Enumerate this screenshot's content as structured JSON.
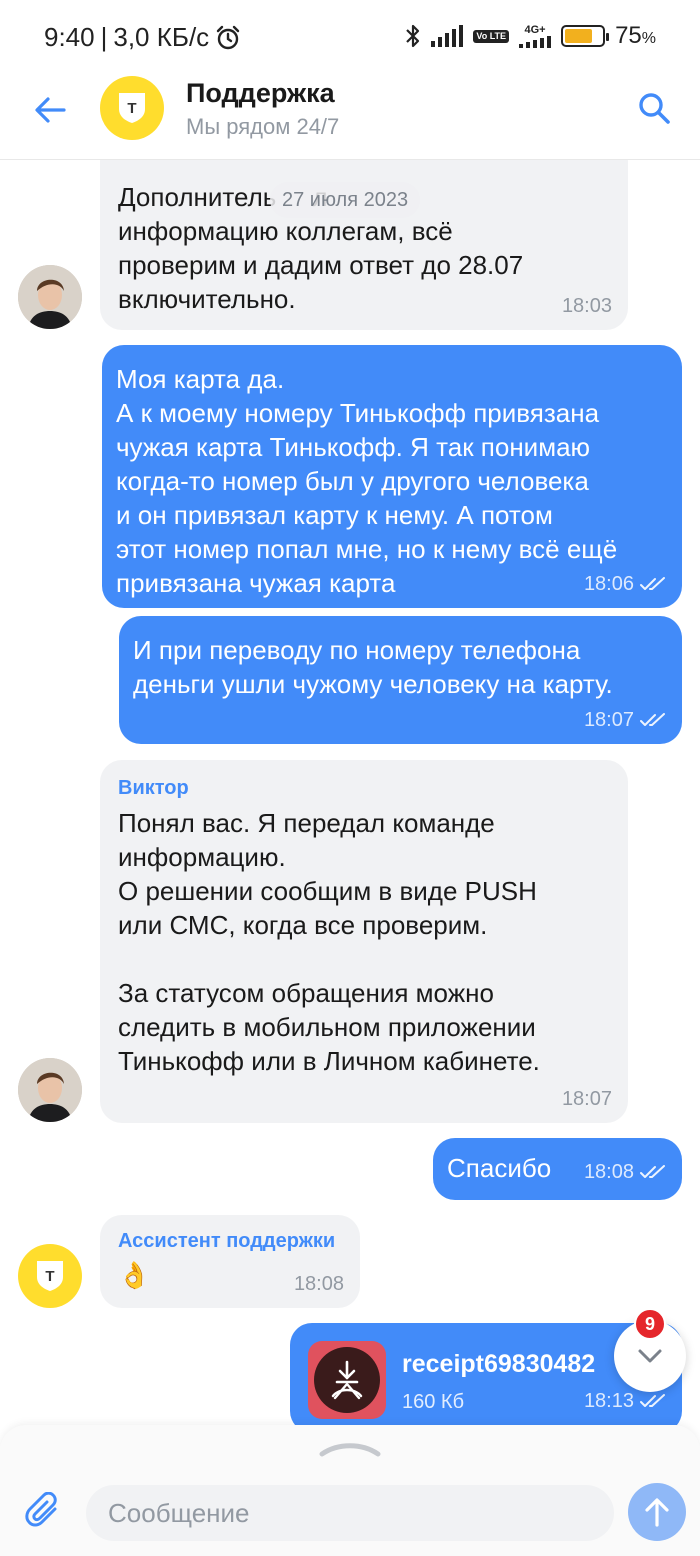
{
  "status_bar": {
    "time": "9:40",
    "separator": "|",
    "speed": "3,0 КБ/с",
    "volte": "Vo LTE",
    "network": "4G+",
    "battery_level": 0.75,
    "battery_percent": "75",
    "battery_unit": "%"
  },
  "header": {
    "title": "Поддержка",
    "subtitle": "Мы рядом 24/7",
    "brand_letter": "Т",
    "accent_color": "#428bf9"
  },
  "chat": {
    "date_separator": "27 июля 2023",
    "messages": [
      {
        "direction": "in",
        "text": "Дополнитель     л\nинформацию коллегам, всё\nпроверим и дадим ответ до 28.07\nвключительно.",
        "time": "18:03"
      },
      {
        "direction": "out",
        "text": "Моя карта да.\nА к моему номеру Тинькофф привязана\nчужая карта Тинькофф. Я так понимаю\nкогда-то номер был у другого человека\nи он привязал карту к нему. А потом\nэтот номер попал мне, но к нему всё ещё\nпривязана чужая карта",
        "time": "18:06"
      },
      {
        "direction": "out",
        "text": "И при переводу по номеру телефона\nденьги ушли чужому человеку на карту.",
        "time": "18:07"
      },
      {
        "direction": "in",
        "sender": "Виктор",
        "text": "Понял вас. Я передал команде\nинформацию.\nО решении сообщим в виде PUSH\nили СМС, когда все проверим.\n\nЗа статусом обращения можно\nследить в мобильном приложении\nТинькофф или в Личном кабинете.",
        "time": "18:07"
      },
      {
        "direction": "out",
        "text": "Спасибо",
        "time": "18:08"
      },
      {
        "direction": "in",
        "sender": "Ассистент поддержки",
        "text": "👌",
        "time": "18:08"
      },
      {
        "direction": "out",
        "file_name": "receipt69830482",
        "file_size": "160 Кб",
        "time": "18:13"
      }
    ],
    "unread_count": "9"
  },
  "composer": {
    "placeholder": "Сообщение"
  }
}
